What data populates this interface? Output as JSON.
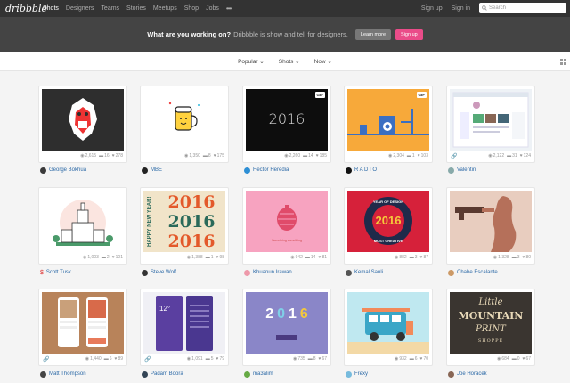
{
  "nav": {
    "logo": "dribbble",
    "items": [
      "Shots",
      "Designers",
      "Teams",
      "Stories",
      "Meetups",
      "Shop",
      "Jobs"
    ],
    "more": "•••",
    "signup": "Sign up",
    "signin": "Sign in",
    "search_placeholder": "Search"
  },
  "banner": {
    "question": "What are you working on?",
    "rest": "Dribbble is show and tell for designers.",
    "learn_more": "Learn more",
    "signup": "Sign up"
  },
  "filters": [
    "Popular ⌄",
    "Shots ⌄",
    "Now ⌄"
  ],
  "shots": [
    {
      "views": "2,615",
      "comments": "16",
      "likes": "278",
      "author": "George Bokhua",
      "avatar": "#3a3a3a"
    },
    {
      "views": "1,350",
      "comments": "8",
      "likes": "175",
      "author": "MBE",
      "avatar": "#222"
    },
    {
      "views": "2,260",
      "comments": "14",
      "likes": "185",
      "author": "Hector Heredia",
      "avatar": "#2d8fd5",
      "gif": "GIF"
    },
    {
      "views": "2,304",
      "comments": "1",
      "likes": "103",
      "author": "R A D I O",
      "avatar": "#111",
      "gif": "GIF"
    },
    {
      "views": "2,122",
      "comments": "31",
      "likes": "124",
      "author": "Valentin",
      "avatar": "#8aa"
    },
    {
      "views": "1,003",
      "comments": "2",
      "likes": "101",
      "author": "Scott Tusk",
      "avatar": "#d33",
      "badge": "$"
    },
    {
      "views": "1,388",
      "comments": "1",
      "likes": "98",
      "author": "Steve Wolf",
      "avatar": "#333"
    },
    {
      "views": "942",
      "comments": "14",
      "likes": "81",
      "author": "Khuanun Irawan",
      "avatar": "#e9a"
    },
    {
      "views": "882",
      "comments": "3",
      "likes": "87",
      "author": "Kemal Sanli",
      "avatar": "#555"
    },
    {
      "views": "1,328",
      "comments": "3",
      "likes": "80",
      "author": "Chabe Escalante",
      "avatar": "#c96"
    },
    {
      "views": "1,440",
      "comments": "6",
      "likes": "89",
      "author": "Matt Thompson",
      "avatar": "#444"
    },
    {
      "views": "1,091",
      "comments": "5",
      "likes": "79",
      "author": "Padam Boora",
      "avatar": "#345"
    },
    {
      "views": "735",
      "comments": "8",
      "likes": "67",
      "author": "ma3alim",
      "avatar": "#6a4"
    },
    {
      "views": "932",
      "comments": "6",
      "likes": "70",
      "author": "Frexy",
      "avatar": "#7bd"
    },
    {
      "views": "684",
      "comments": "0",
      "likes": "67",
      "author": "Joe Horacek",
      "avatar": "#865"
    }
  ],
  "thumb_text": {
    "t3": "2016",
    "t7": [
      "2016",
      "2016",
      "2016"
    ],
    "t7_side": "HAPPY NEW YEAR!",
    "t8_caption": "Something something",
    "t9": [
      "YEAR OF DESIGN",
      "2016",
      "MOST CREATIVE"
    ],
    "t12_time": "12°",
    "t13": [
      "2",
      "0",
      "1",
      "6"
    ],
    "t15": [
      "Little",
      "MOUNTAIN",
      "PRINT",
      "SHOPPE"
    ]
  },
  "colors": {
    "accent": "#ea4c89",
    "link": "#2d6aa7"
  }
}
